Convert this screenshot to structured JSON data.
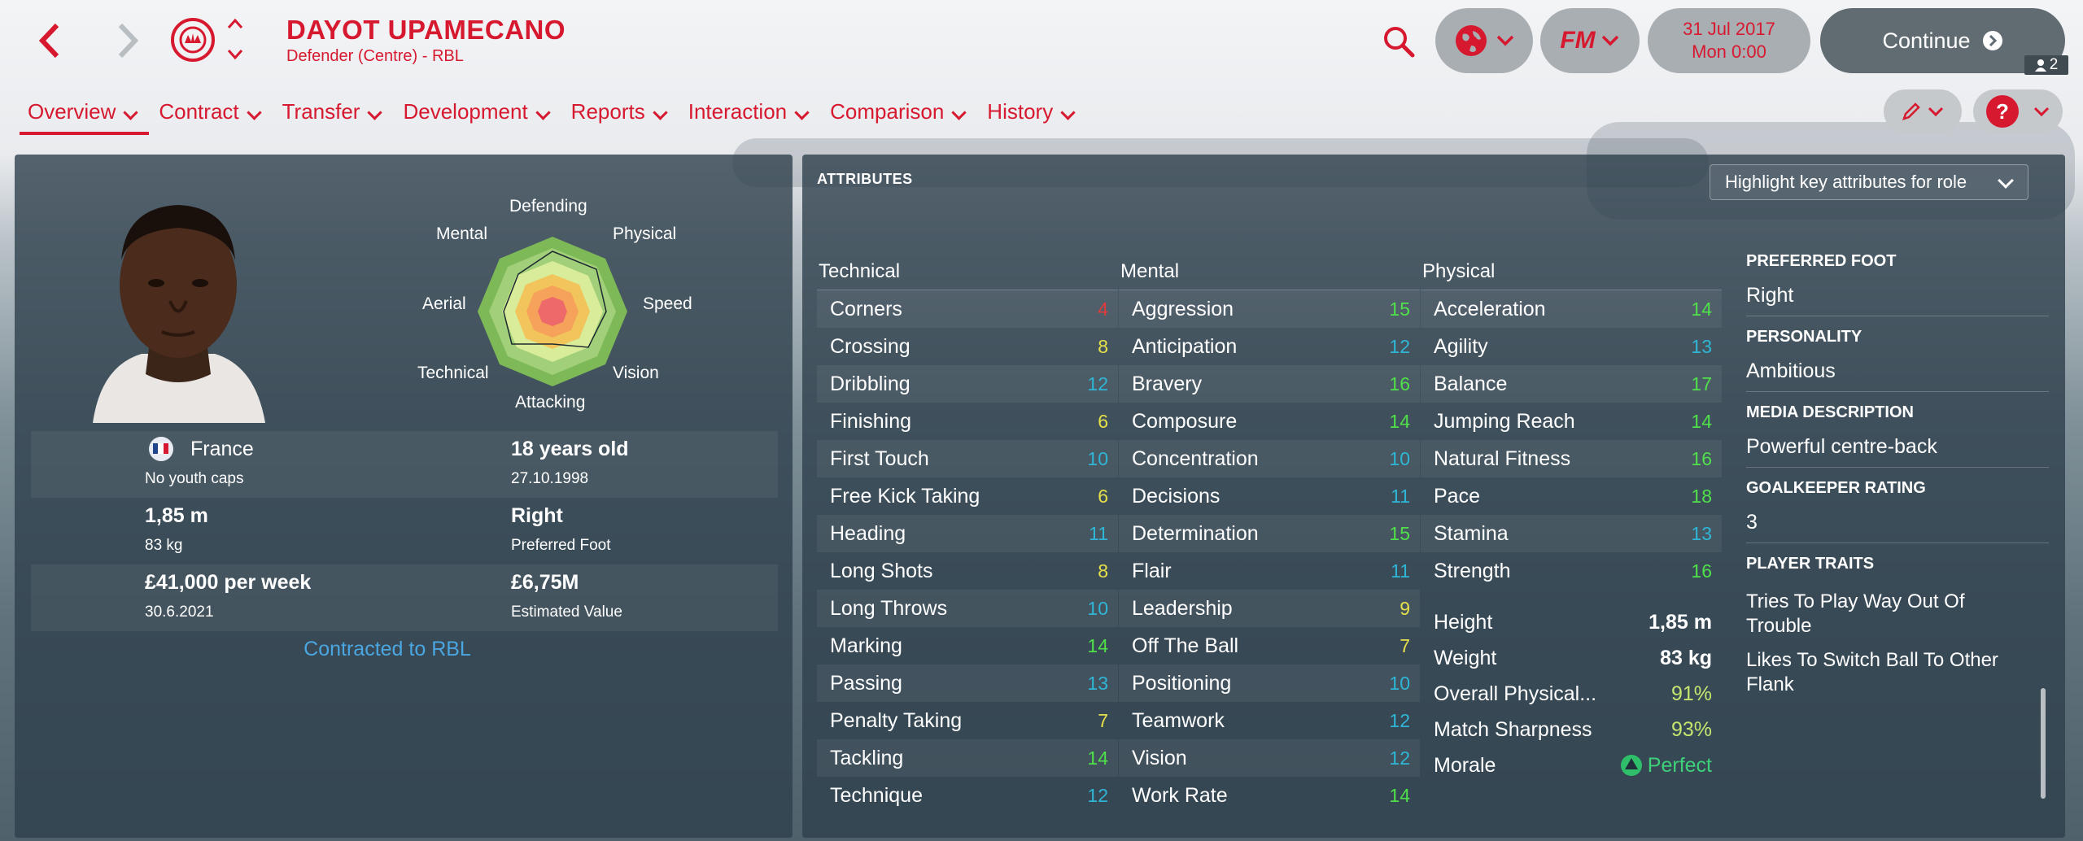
{
  "header": {
    "player_name": "DAYOT UPAMECANO",
    "player_sub": "Defender (Centre) - RBL",
    "date_line1": "31 Jul 2017",
    "date_line2": "Mon 0:00",
    "continue_label": "Continue",
    "fm_label": "FM",
    "user_count": "2"
  },
  "tabs": [
    {
      "label": "Overview"
    },
    {
      "label": "Contract"
    },
    {
      "label": "Transfer"
    },
    {
      "label": "Development"
    },
    {
      "label": "Reports"
    },
    {
      "label": "Interaction"
    },
    {
      "label": "Comparison"
    },
    {
      "label": "History"
    }
  ],
  "radar": {
    "labels": {
      "top": "Defending",
      "top_right": "Physical",
      "right": "Speed",
      "bottom_right": "Vision",
      "bottom": "Attacking",
      "bottom_left": "Technical",
      "left": "Aerial",
      "top_left": "Mental"
    }
  },
  "profile": {
    "nation": "France",
    "caps": "No youth caps",
    "age": "18 years old",
    "dob": "27.10.1998",
    "height": "1,85 m",
    "weight": "83 kg",
    "foot": "Right",
    "foot_label": "Preferred Foot",
    "wage": "£41,000 per week",
    "contract_end": "30.6.2021",
    "value": "£6,75M",
    "value_label": "Estimated Value",
    "contracted": "Contracted to RBL"
  },
  "attributes": {
    "title": "ATTRIBUTES",
    "highlight_label": "Highlight key attributes for role",
    "technical_head": "Technical",
    "mental_head": "Mental",
    "physical_head": "Physical",
    "technical": [
      {
        "name": "Corners",
        "value": "4",
        "color": "#e03a3a"
      },
      {
        "name": "Crossing",
        "value": "8",
        "color": "#e6e04a"
      },
      {
        "name": "Dribbling",
        "value": "12",
        "color": "#2fb6d6"
      },
      {
        "name": "Finishing",
        "value": "6",
        "color": "#e6e04a"
      },
      {
        "name": "First Touch",
        "value": "10",
        "color": "#2fb6d6"
      },
      {
        "name": "Free Kick Taking",
        "value": "6",
        "color": "#e6e04a"
      },
      {
        "name": "Heading",
        "value": "11",
        "color": "#2fb6d6"
      },
      {
        "name": "Long Shots",
        "value": "8",
        "color": "#e6e04a"
      },
      {
        "name": "Long Throws",
        "value": "10",
        "color": "#2fb6d6"
      },
      {
        "name": "Marking",
        "value": "14",
        "color": "#4fe04a"
      },
      {
        "name": "Passing",
        "value": "13",
        "color": "#2fb6d6"
      },
      {
        "name": "Penalty Taking",
        "value": "7",
        "color": "#e6e04a"
      },
      {
        "name": "Tackling",
        "value": "14",
        "color": "#4fe04a"
      },
      {
        "name": "Technique",
        "value": "12",
        "color": "#2fb6d6"
      }
    ],
    "mental": [
      {
        "name": "Aggression",
        "value": "15",
        "color": "#4fe04a"
      },
      {
        "name": "Anticipation",
        "value": "12",
        "color": "#2fb6d6"
      },
      {
        "name": "Bravery",
        "value": "16",
        "color": "#4fe04a"
      },
      {
        "name": "Composure",
        "value": "14",
        "color": "#4fe04a"
      },
      {
        "name": "Concentration",
        "value": "10",
        "color": "#2fb6d6"
      },
      {
        "name": "Decisions",
        "value": "11",
        "color": "#2fb6d6"
      },
      {
        "name": "Determination",
        "value": "15",
        "color": "#4fe04a"
      },
      {
        "name": "Flair",
        "value": "11",
        "color": "#2fb6d6"
      },
      {
        "name": "Leadership",
        "value": "9",
        "color": "#e6e04a"
      },
      {
        "name": "Off The Ball",
        "value": "7",
        "color": "#e6e04a"
      },
      {
        "name": "Positioning",
        "value": "10",
        "color": "#2fb6d6"
      },
      {
        "name": "Teamwork",
        "value": "12",
        "color": "#2fb6d6"
      },
      {
        "name": "Vision",
        "value": "12",
        "color": "#2fb6d6"
      },
      {
        "name": "Work Rate",
        "value": "14",
        "color": "#4fe04a"
      }
    ],
    "physical": [
      {
        "name": "Acceleration",
        "value": "14",
        "color": "#4fe04a"
      },
      {
        "name": "Agility",
        "value": "13",
        "color": "#2fb6d6"
      },
      {
        "name": "Balance",
        "value": "17",
        "color": "#4fe04a"
      },
      {
        "name": "Jumping Reach",
        "value": "14",
        "color": "#4fe04a"
      },
      {
        "name": "Natural Fitness",
        "value": "16",
        "color": "#4fe04a"
      },
      {
        "name": "Pace",
        "value": "18",
        "color": "#4fe04a"
      },
      {
        "name": "Stamina",
        "value": "13",
        "color": "#2fb6d6"
      },
      {
        "name": "Strength",
        "value": "16",
        "color": "#4fe04a"
      }
    ],
    "stats": {
      "height_label": "Height",
      "height": "1,85 m",
      "weight_label": "Weight",
      "weight": "83 kg",
      "cond_label": "Overall Physical...",
      "cond": "91%",
      "sharp_label": "Match Sharpness",
      "sharp": "93%",
      "morale_label": "Morale",
      "morale": "Perfect"
    }
  },
  "side": {
    "foot_h": "PREFERRED FOOT",
    "foot": "Right",
    "pers_h": "PERSONALITY",
    "pers": "Ambitious",
    "media_h": "MEDIA DESCRIPTION",
    "media": "Powerful centre-back",
    "gk_h": "GOALKEEPER RATING",
    "gk": "3",
    "traits_h": "PLAYER TRAITS",
    "traits": [
      "Tries To Play Way Out Of Trouble",
      "Likes To Switch Ball To Other Flank"
    ]
  },
  "colors": {
    "accent": "#d7192f",
    "panel": "#2e404c",
    "link": "#4aa6e0"
  }
}
